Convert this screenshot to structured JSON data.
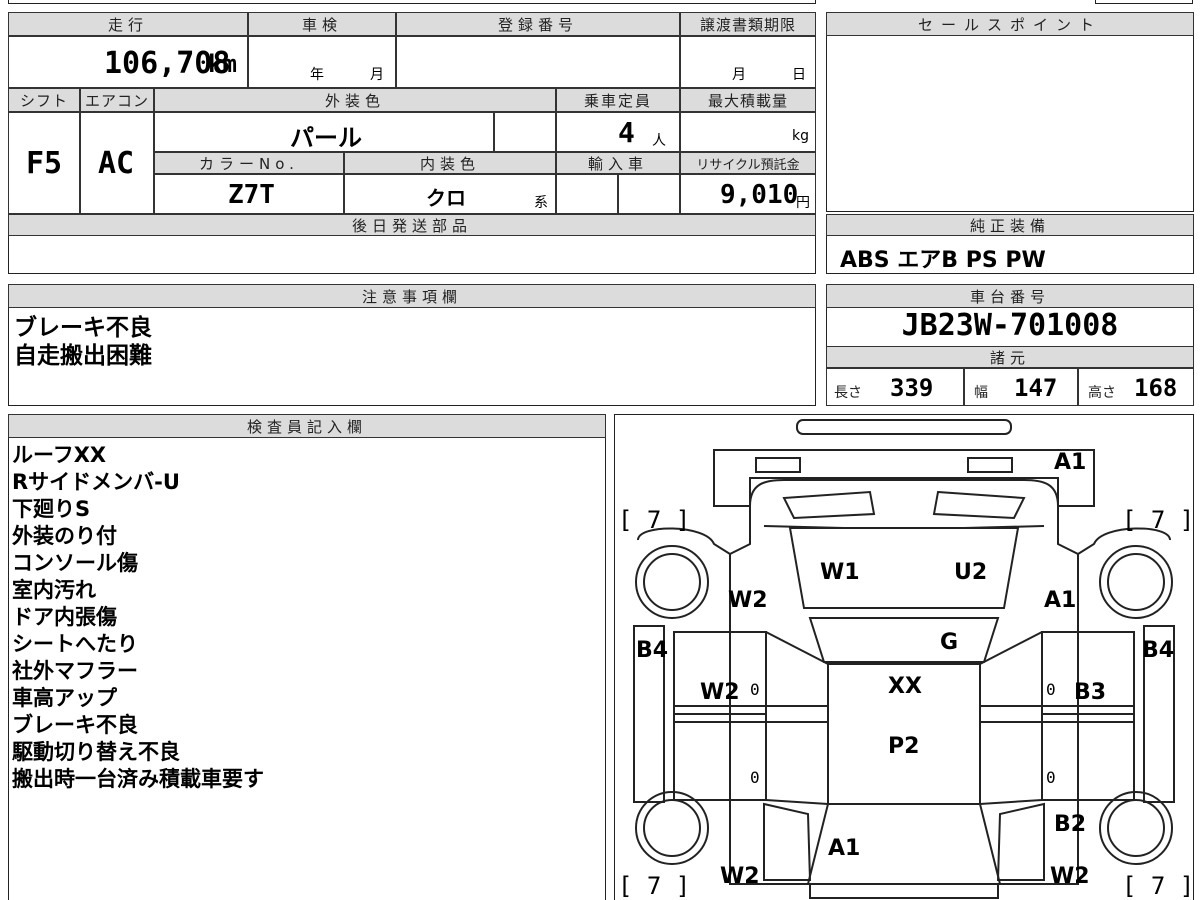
{
  "top": {
    "mileage_label": "走行",
    "mileage": "106,708",
    "mileage_unit": "km",
    "shaken_label": "車検",
    "shaken_year": "年",
    "shaken_month": "月",
    "registration_label": "登録番号",
    "transfer_label": "譲渡書類期限",
    "transfer_month": "月",
    "transfer_day": "日"
  },
  "mid": {
    "shift_label": "シフト",
    "shift": "F5",
    "ac_label": "エアコン",
    "ac": "AC",
    "exterior_label": "外装色",
    "exterior": "パール",
    "capacity_label": "乗車定員",
    "capacity": "4",
    "capacity_unit": "人",
    "maxload_label": "最大積載量",
    "maxload_unit": "kg",
    "colorno_label": "カラーNo.",
    "colorno": "Z7T",
    "interior_label": "内装色",
    "interior": "クロ",
    "interior_suffix": "系",
    "import_label": "輸入車",
    "recycle_label": "リサイクル預託金",
    "recycle": "9,010",
    "recycle_unit": "円"
  },
  "later_parts_label": "後日発送部品",
  "sales_point_label": "セールスポイント",
  "equipment": {
    "label": "純正装備",
    "value": "ABS エアB PS PW"
  },
  "notes": {
    "label": "注意事項欄",
    "lines": [
      "ブレーキ不良",
      "自走搬出困難"
    ]
  },
  "chassis": {
    "label": "車台番号",
    "value": "JB23W-701008"
  },
  "specs": {
    "label": "諸元",
    "length_label": "長さ",
    "length": "339",
    "width_label": "幅",
    "width": "147",
    "height_label": "高さ",
    "height": "168"
  },
  "inspector": {
    "label": "検査員記入欄",
    "lines": [
      "ルーフXX",
      "Rサイドメンバ-U",
      "下廻りS",
      "外装のり付",
      "コンソール傷",
      "室内汚れ",
      "ドア内張傷",
      "シートへたり",
      "社外マフラー",
      "車高アップ",
      "ブレーキ不良",
      "駆動切り替え不良",
      "搬出時一台済み積載車要す"
    ]
  },
  "diagram": {
    "marks": {
      "a1_top": "A1",
      "bracket_tl": "[ 7 ]",
      "bracket_tr": "[ 7 ]",
      "bracket_bl": "[ 7 ]",
      "bracket_br": "[ 7 ]",
      "w1": "W1",
      "u2": "U2",
      "w2_left_top": "W2",
      "a1_right": "A1",
      "g": "G",
      "b4_left": "B4",
      "b4_right": "B4",
      "w2_left_mid": "W2",
      "xx": "XX",
      "b3": "B3",
      "p2": "P2",
      "b2": "B2",
      "a1_bottom": "A1",
      "w2_left_bottom": "W2",
      "w2_right_bottom": "W2",
      "zero1": "0",
      "zero2": "0",
      "zero3": "0",
      "zero4": "0"
    }
  }
}
